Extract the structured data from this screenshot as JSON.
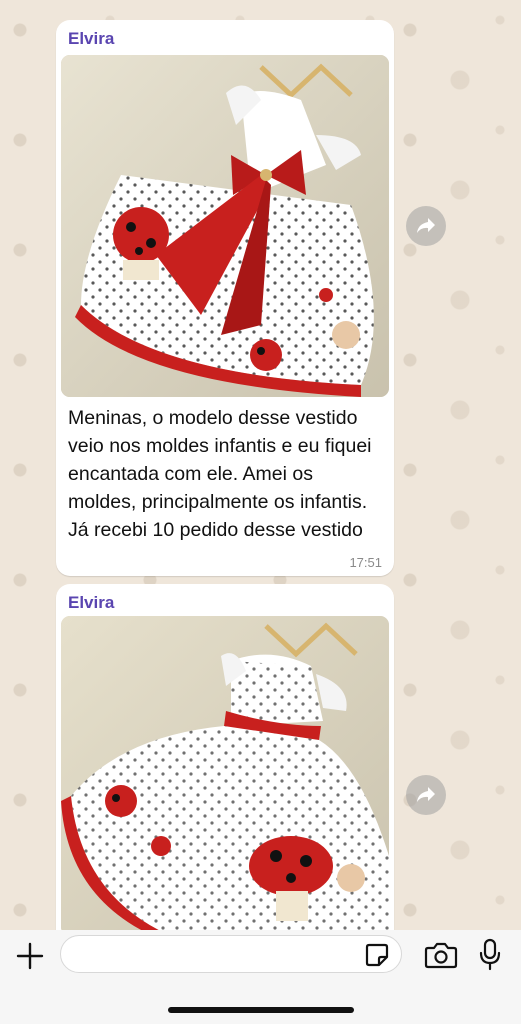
{
  "messages": [
    {
      "sender": "Elvira",
      "image_alt": "Vestido infantil branco com poá preto, laço vermelho e barrado de joaninhas",
      "text": "Meninas, o modelo desse vestido veio nos moldes infantis e eu fiquei encantada com ele. Amei os moldes, principalmente os infantis. Já recebi 10 pedido desse vestido",
      "time": "17:51"
    },
    {
      "sender": "Elvira",
      "image_alt": "Vestido infantil branco com poá preto, faixa vermelha e barrado de joaninhas"
    }
  ],
  "composer": {
    "placeholder": "",
    "icons": [
      "plus-icon",
      "sticker-icon",
      "camera-icon",
      "microphone-icon"
    ]
  },
  "colors": {
    "sender_name": "#5a45b0",
    "dress_red": "#c8201e",
    "chat_background": "#efe6da"
  }
}
